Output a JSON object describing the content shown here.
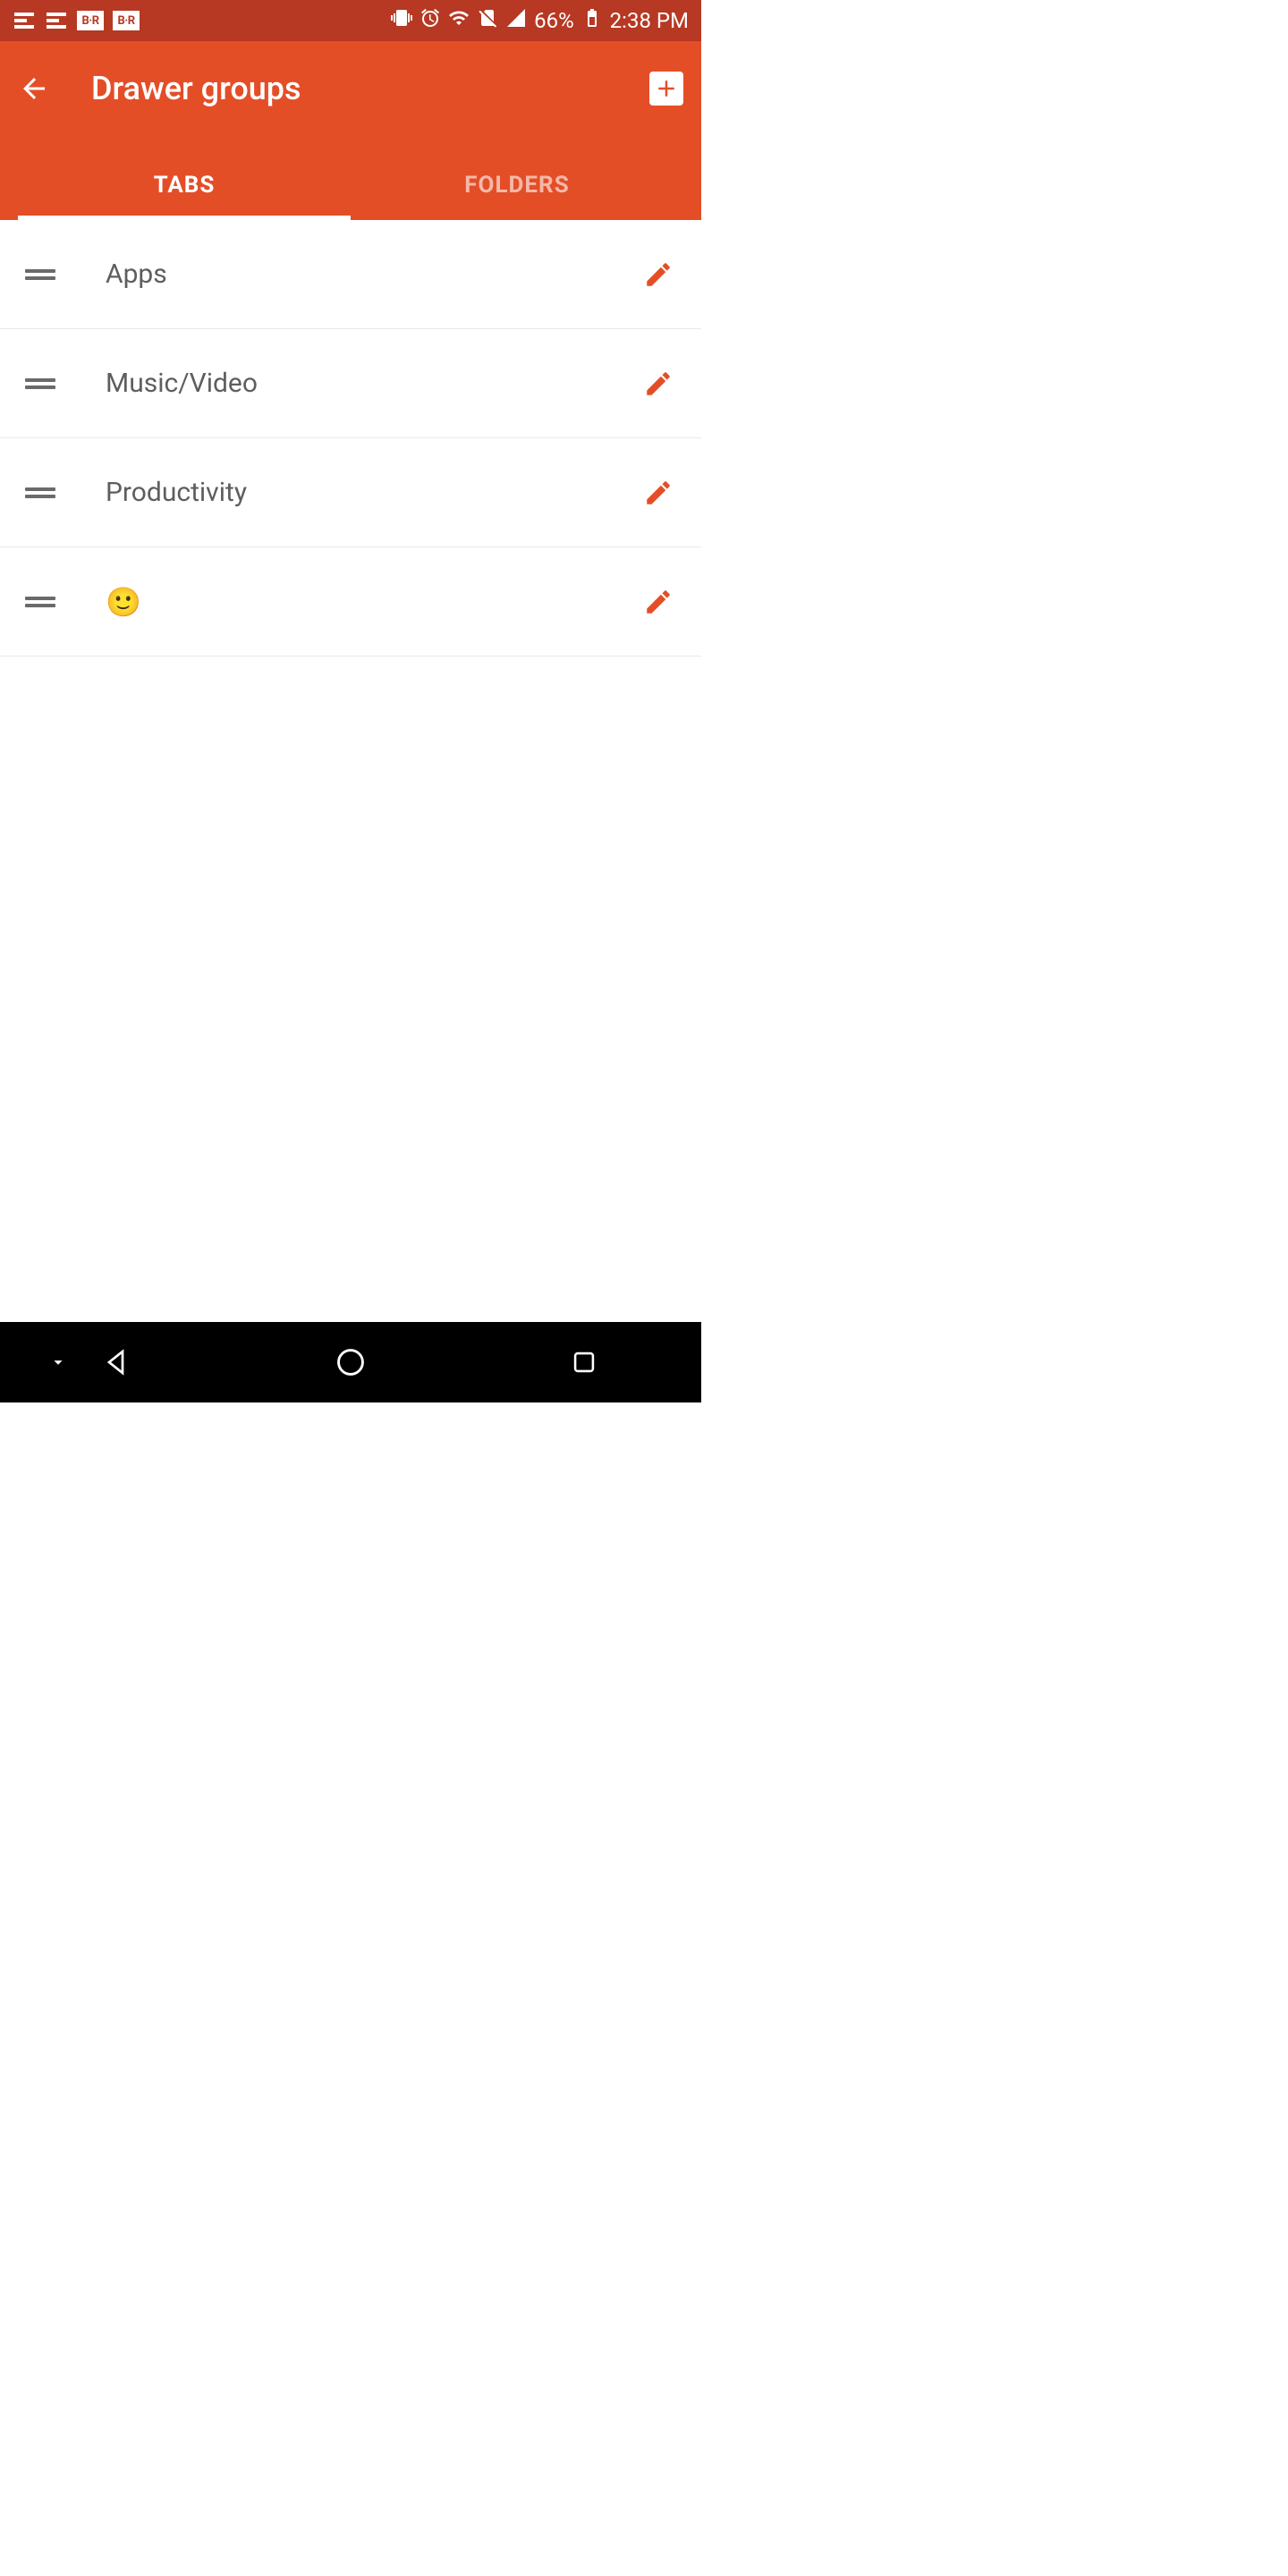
{
  "status": {
    "notif_br": "B·R",
    "battery_pct": "66%",
    "time": "2:38 PM"
  },
  "header": {
    "title": "Drawer groups"
  },
  "tabs": [
    {
      "label": "TABS",
      "active": true
    },
    {
      "label": "FOLDERS",
      "active": false
    }
  ],
  "groups": [
    {
      "label": "Apps"
    },
    {
      "label": "Music/Video"
    },
    {
      "label": "Productivity"
    },
    {
      "label": "🙂"
    }
  ],
  "colors": {
    "accent": "#e44e27",
    "statusbar": "#b73823"
  }
}
